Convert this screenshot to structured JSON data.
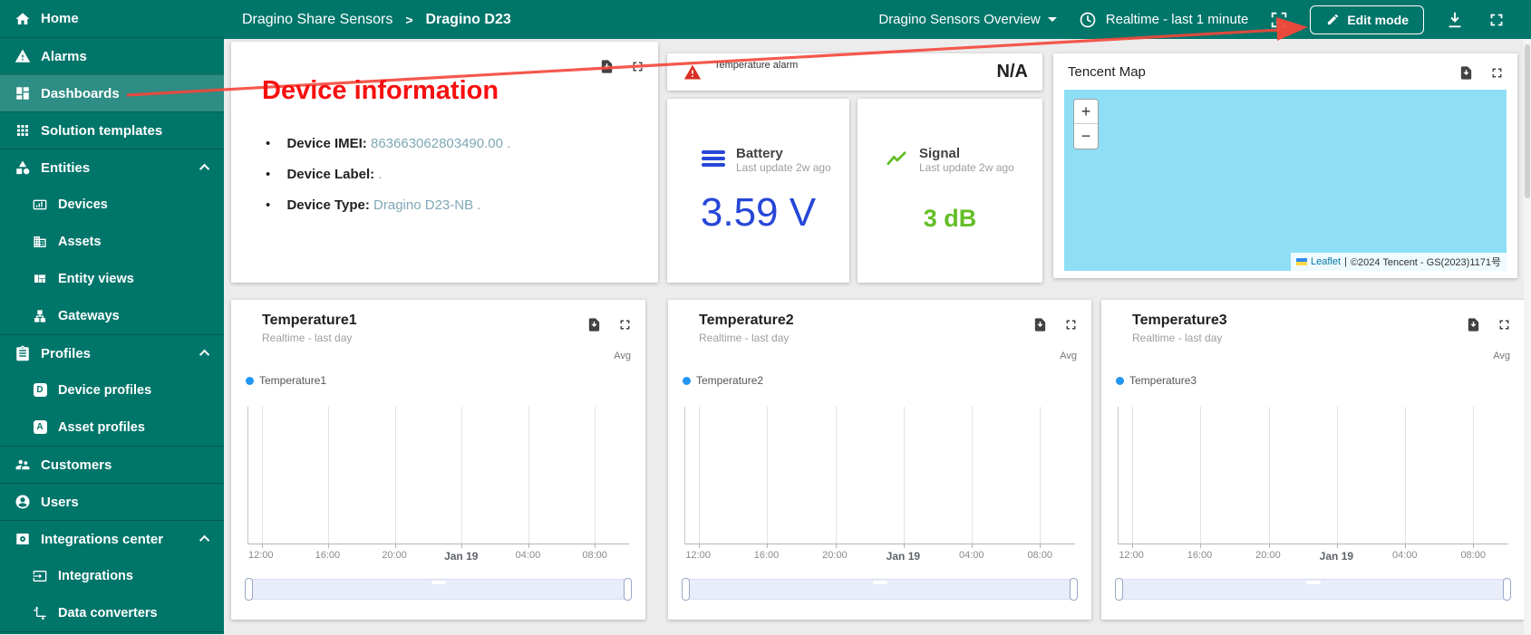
{
  "topbar": {
    "breadcrumb": {
      "parent": "Dragino Share Sensors",
      "separator": ">",
      "current": "Dragino D23"
    },
    "state_selector": "Dragino Sensors Overview",
    "timewindow": "Realtime - last 1 minute",
    "edit_button": "Edit mode"
  },
  "sidebar": {
    "items": [
      {
        "label": "Home"
      },
      {
        "label": "Alarms"
      },
      {
        "label": "Dashboards"
      },
      {
        "label": "Solution templates"
      },
      {
        "label": "Entities"
      },
      {
        "label": "Devices"
      },
      {
        "label": "Assets"
      },
      {
        "label": "Entity views"
      },
      {
        "label": "Gateways"
      },
      {
        "label": "Profiles"
      },
      {
        "label": "Device profiles",
        "icon_letter": "D"
      },
      {
        "label": "Asset profiles",
        "icon_letter": "A"
      },
      {
        "label": "Customers"
      },
      {
        "label": "Users"
      },
      {
        "label": "Integrations center"
      },
      {
        "label": "Integrations"
      },
      {
        "label": "Data converters"
      }
    ]
  },
  "annotation": {
    "label": "Device information"
  },
  "device_info": {
    "rows": [
      {
        "label": "Device IMEI:",
        "value": "863663062803490.00",
        "suffix": " ."
      },
      {
        "label": "Device Label:",
        "value": "",
        "suffix": " ."
      },
      {
        "label": "Device Type:",
        "value": "Dragino D23-NB",
        "suffix": " ."
      }
    ]
  },
  "alarm": {
    "title": "Temperature alarm",
    "value": "N/A"
  },
  "battery": {
    "title": "Battery",
    "subtitle": "Last update 2w ago",
    "value": "3.59 V"
  },
  "signal": {
    "title": "Signal",
    "subtitle": "Last update 2w ago",
    "value": "3 dB"
  },
  "map": {
    "title": "Tencent Map",
    "zoom_in": "+",
    "zoom_out": "−",
    "attribution": {
      "leaflet": "Leaflet",
      "separator": "|",
      "text": "©2024 Tencent - GS(2023)1171号"
    }
  },
  "charts": {
    "subtitle": "Realtime - last day",
    "avg_label": "Avg",
    "x_ticks": [
      "12:00",
      "16:00",
      "20:00",
      "Jan 19",
      "04:00",
      "08:00"
    ],
    "items": [
      {
        "title": "Temperature1",
        "legend": "Temperature1"
      },
      {
        "title": "Temperature2",
        "legend": "Temperature2"
      },
      {
        "title": "Temperature3",
        "legend": "Temperature3"
      }
    ]
  },
  "colors": {
    "brand_teal": "#00756a",
    "battery_blue": "#2647d7",
    "signal_green": "#64be27",
    "link_teal": "#7fa8b6",
    "annotation_red": "#f80f0f",
    "map_water": "#8edff6",
    "series_blue": "#2196f3"
  }
}
